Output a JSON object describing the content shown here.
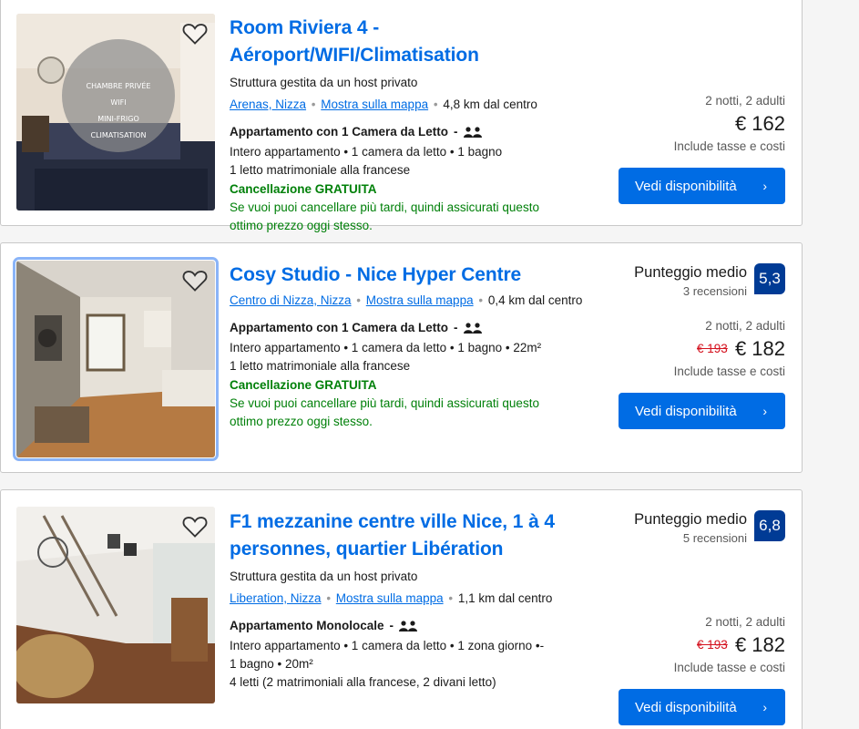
{
  "listings": [
    {
      "title": "Room Riviera 4 - Aéroport/WIFI/Climatisation",
      "subtitle": "Struttura gestita da un host privato",
      "area_link": "Arenas, Nizza",
      "map_link": "Mostra sulla mappa",
      "distance": "4,8 km dal centro",
      "unit_type": "Appartamento con 1 Camera da Letto",
      "desc_lines": [
        "Intero appartamento • 1 camera da letto • 1 bagno",
        "1 letto matrimoniale alla francese"
      ],
      "cancellation": "Cancellazione GRATUITA",
      "cancellation_note": "Se vuoi puoi cancellare più tardi, quindi assicurati questo ottimo prezzo oggi stesso.",
      "nights": "2 notti, 2 adulti",
      "old_price": "",
      "price": "€ 162",
      "taxes": "Include tasse e costi",
      "button": "Vedi disponibilità",
      "photo_overlay": [
        "CHAMBRE PRIVÉE",
        "WIFI",
        "MINI-FRIGO",
        "CLIMATISATION"
      ]
    },
    {
      "title": "Cosy Studio - Nice Hyper Centre",
      "area_link": "Centro di Nizza, Nizza",
      "map_link": "Mostra sulla mappa",
      "distance": "0,4 km dal centro",
      "unit_type": "Appartamento con 1 Camera da Letto",
      "desc_lines": [
        "Intero appartamento • 1 camera da letto • 1 bagno • 22m²",
        "1 letto matrimoniale alla francese"
      ],
      "cancellation": "Cancellazione GRATUITA",
      "cancellation_note": "Se vuoi puoi cancellare più tardi, quindi assicurati questo ottimo prezzo oggi stesso.",
      "score_label": "Punteggio medio",
      "reviews": "3 recensioni",
      "score": "5,3",
      "nights": "2 notti, 2 adulti",
      "old_price": "€ 193",
      "price": "€ 182",
      "taxes": "Include tasse e costi",
      "button": "Vedi disponibilità"
    },
    {
      "title_line1": "F1 mezzanine centre ville Nice, 1 à 4",
      "title_line2": "personnes, quartier Libération",
      "subtitle": "Struttura gestita da un host privato",
      "area_link": "Liberation, Nizza",
      "map_link": "Mostra sulla mappa",
      "distance": "1,1 km dal centro",
      "unit_type": "Appartamento Monolocale",
      "desc_lines": [
        "Intero appartamento • 1 camera da letto • 1 zona giorno •-",
        "1 bagno • 20m²",
        "4 letti (2 matrimoniali alla francese, 2 divani letto)"
      ],
      "score_label": "Punteggio medio",
      "reviews": "5 recensioni",
      "score": "6,8",
      "nights": "2 notti, 2 adulti",
      "old_price": "€ 193",
      "price": "€ 182",
      "taxes": "Include tasse e costi",
      "button": "Vedi disponibilità"
    }
  ],
  "colors": {
    "link_blue": "#006ce4",
    "score_blue": "#003b95",
    "green": "#008009",
    "strike_red": "#d4111e"
  },
  "icons": {
    "favorite": "heart-icon",
    "occupancy": "two-persons-icon",
    "chevron": "chevron-right-icon"
  }
}
